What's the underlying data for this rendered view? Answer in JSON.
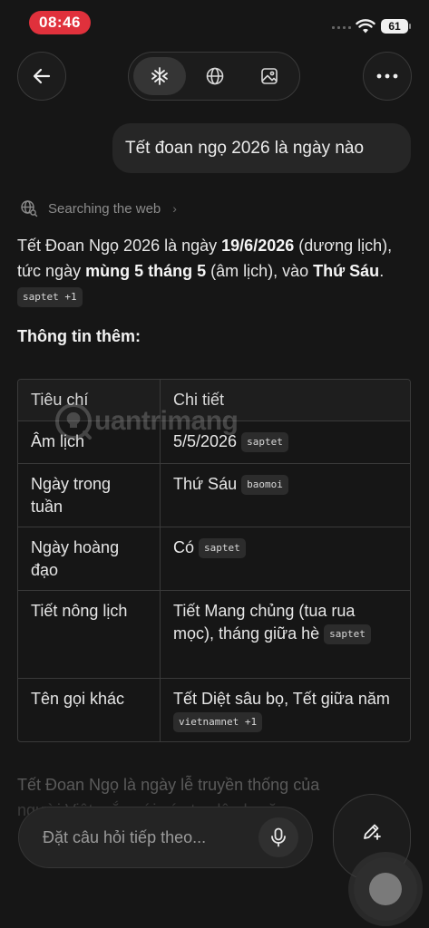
{
  "status_bar": {
    "time": "08:46",
    "battery": "61"
  },
  "toolbar": {
    "back_icon": "arrow-left-icon",
    "modes": [
      {
        "icon": "deep-research-icon",
        "active": true
      },
      {
        "icon": "globe-icon",
        "active": false
      },
      {
        "icon": "image-icon",
        "active": false
      }
    ],
    "more_icon": "more-horizontal-icon"
  },
  "user_message": "Tết đoan ngọ 2026 là ngày nào",
  "searching": {
    "label": "Searching the web",
    "chevron": "›"
  },
  "answer": {
    "p1": "Tết Đoan Ngọ 2026 là ngày ",
    "date_bold": "19/6/2026",
    "p2": " (dương lịch), tức ngày ",
    "lunar_bold": "mùng 5 tháng 5",
    "p3": " (âm lịch), vào ",
    "weekday_bold": "Thứ Sáu",
    "p4": ".",
    "source_tag": "saptet +1"
  },
  "section_title": "Thông tin thêm:",
  "table": {
    "headers": [
      "Tiêu chí",
      "Chi tiết"
    ],
    "rows": [
      {
        "label": "Âm lịch",
        "value": "5/5/2026",
        "tag": "saptet"
      },
      {
        "label": "Ngày trong tuần",
        "value": "Thứ Sáu",
        "tag": "baomoi"
      },
      {
        "label": "Ngày hoàng đạo",
        "value": "Có",
        "tag": "saptet"
      },
      {
        "label": "Tiết nông lịch",
        "value": "Tiết Mang chủng (tua rua mọc), tháng giữa hè",
        "tag": "saptet"
      },
      {
        "label": "Tên gọi khác",
        "value": "Tết Diệt sâu bọ, Tết giữa năm",
        "tag": "vietnamnet +1"
      }
    ]
  },
  "watermark": "uantrimang",
  "faded_text": {
    "line1": "Tết Đoan Ngọ là ngày lễ truyền thống của",
    "line2": "người Việt, gắn với các tục lệ như ăn"
  },
  "composer": {
    "placeholder": "Đặt câu hỏi tiếp theo...",
    "mic_icon": "microphone-icon"
  },
  "compose_button": {
    "icon": "new-chat-pencil-icon"
  },
  "colors": {
    "status_pill": "#e0313c",
    "background": "#161616"
  }
}
